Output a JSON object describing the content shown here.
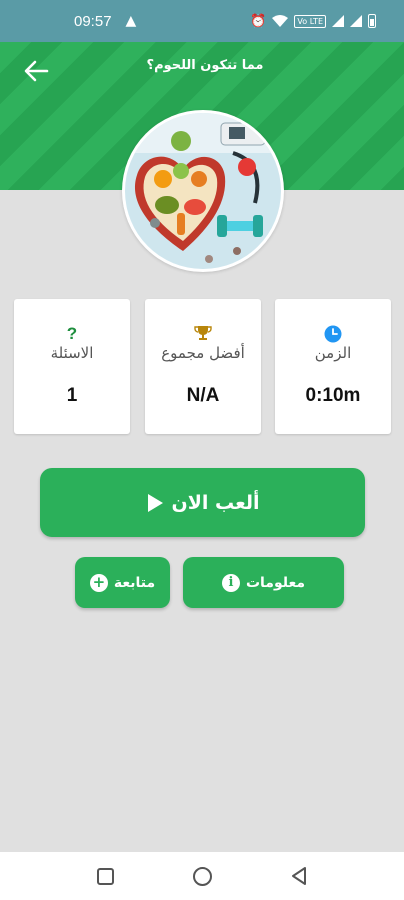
{
  "status_bar": {
    "time": "09:57",
    "warning_icon": "warning-icon",
    "alarm_icon": "alarm-icon",
    "wifi_icon": "wifi-icon",
    "volte_label": "Vo LTE",
    "signal_icon": "signal-icon",
    "battery_icon": "battery-icon"
  },
  "header": {
    "title": "مما تتكون اللحوم؟",
    "back_icon": "arrow-left-icon"
  },
  "stats": {
    "questions": {
      "icon": "question-mark-icon",
      "label": "الاسئلة",
      "value": "1"
    },
    "best": {
      "icon": "trophy-icon",
      "label": "أفضل مجموع",
      "value": "N/A"
    },
    "time": {
      "icon": "clock-icon",
      "label": "الزمن",
      "value": "0:10m"
    }
  },
  "buttons": {
    "play": "ألعب الان",
    "follow": "متابعة",
    "info": "معلومات"
  },
  "colors": {
    "primary_green": "#2bb05a",
    "status_bar": "#5a9ba6",
    "background": "#e0e0e0",
    "question_green": "#1e8e3e",
    "trophy_gold": "#b8860b",
    "clock_blue": "#2196f3"
  }
}
